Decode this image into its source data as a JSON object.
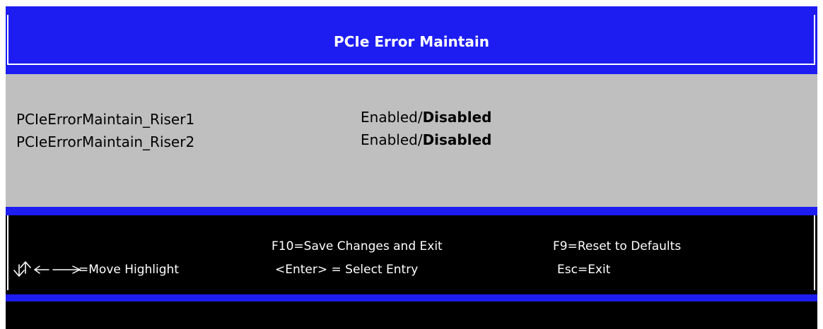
{
  "header": {
    "title": "PCIe Error Maintain"
  },
  "settings": [
    {
      "label": "PCIeErrorMaintain_Riser1",
      "option_normal": "Enabled/",
      "option_bold": "Disabled"
    },
    {
      "label": "PCIeErrorMaintain_Riser2",
      "option_normal": "Enabled/",
      "option_bold": "Disabled"
    }
  ],
  "footer": {
    "save_exit": "F10=Save Changes and Exit",
    "reset_defaults": "F9=Reset to Defaults",
    "move_highlight": "=Move Highlight",
    "select_entry": "<Enter> = Select Entry",
    "exit": "Esc=Exit",
    "nav_icon": "arrow-keys-icon"
  },
  "colors": {
    "blue": "#1d1df2",
    "panel_gray": "#bfbfbf",
    "footer_black": "#000000",
    "text_white": "#ffffff"
  }
}
